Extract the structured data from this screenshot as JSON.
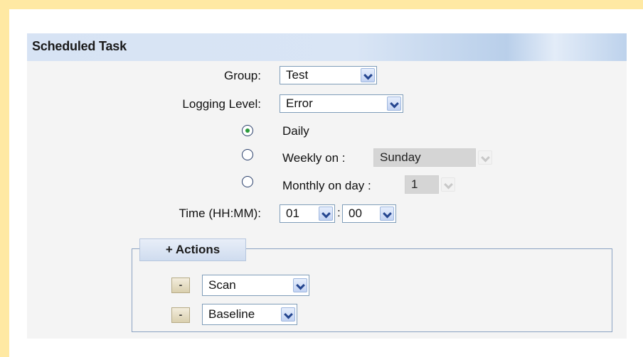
{
  "panel": {
    "title": "Scheduled Task"
  },
  "group": {
    "label": "Group:",
    "value": "Test"
  },
  "logging": {
    "label": "Logging Level:",
    "value": "Error"
  },
  "schedule": {
    "daily": {
      "label": "Daily",
      "selected": true
    },
    "weekly": {
      "label": "Weekly on :",
      "value": "Sunday",
      "selected": false
    },
    "monthly": {
      "label": "Monthly on day :",
      "value": "1",
      "selected": false
    }
  },
  "time": {
    "label": "Time (HH:MM):",
    "hour": "01",
    "separator": ":",
    "minute": "00"
  },
  "actions": {
    "legend": "+ Actions",
    "remove_label": "-",
    "items": [
      {
        "value": "Scan"
      },
      {
        "value": "Baseline"
      }
    ]
  }
}
